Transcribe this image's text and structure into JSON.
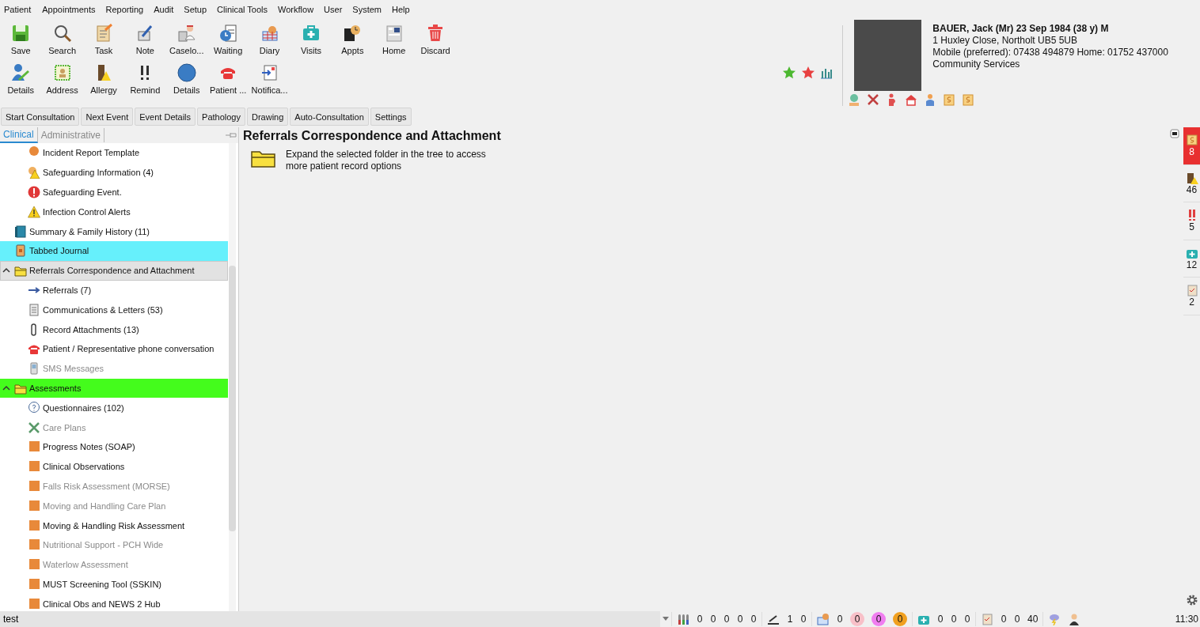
{
  "menu": [
    "Patient",
    "Appointments",
    "Reporting",
    "Audit",
    "Setup",
    "Clinical Tools",
    "Workflow",
    "User",
    "System",
    "Help"
  ],
  "toolbar": [
    [
      {
        "label": "Save"
      },
      {
        "label": "Search"
      },
      {
        "label": "Task"
      },
      {
        "label": "Note"
      },
      {
        "label": "Caselo..."
      },
      {
        "label": "Waiting"
      },
      {
        "label": "Diary"
      },
      {
        "label": "Visits"
      },
      {
        "label": "Appts"
      },
      {
        "label": "Home"
      },
      {
        "label": "Discard"
      }
    ],
    [
      {
        "label": "Details"
      },
      {
        "label": "Address"
      },
      {
        "label": "Allergy"
      },
      {
        "label": "Remind"
      },
      {
        "label": "Details"
      },
      {
        "label": "Patient ..."
      },
      {
        "label": "Notifica..."
      }
    ]
  ],
  "action_buttons": [
    "Start Consultation",
    "Next Event",
    "Event Details",
    "Pathology",
    "Drawing",
    "Auto-Consultation",
    "Settings"
  ],
  "patient": {
    "name_line": "BAUER, Jack (Mr) 23 Sep 1984 (38 y) M",
    "address": "1 Huxley Close, Northolt UB5 5UB",
    "phone": "Mobile (preferred): 07438 494879 Home: 01752 437000",
    "service": "Community Services"
  },
  "side_panel": {
    "tabs": [
      {
        "label": "Clinical",
        "selected": true
      },
      {
        "label": "Administrative",
        "selected": false
      }
    ],
    "tree_continued": [
      {
        "label": "Incident Report Template",
        "kind": "blob",
        "disabled": false,
        "selected": false
      },
      {
        "label": "Safeguarding Information (4)",
        "kind": "hazard",
        "disabled": false,
        "selected": false
      },
      {
        "label": "Safeguarding Event.",
        "kind": "alert",
        "disabled": false,
        "selected": false
      },
      {
        "label": "Infection Control Alerts",
        "kind": "warning",
        "disabled": false,
        "selected": false
      }
    ],
    "tree": [
      {
        "label": "Summary & Family History (11)",
        "kind": "book",
        "disabled": false,
        "selected": false
      },
      {
        "label": "Tabbed Journal",
        "kind": "journal",
        "disabled": false,
        "selected": false,
        "color": "#66f0fc"
      },
      {
        "label": "Referrals Correspondence and Attachment",
        "kind": "folder",
        "disabled": false,
        "selected": true,
        "expanded": true,
        "children": [
          {
            "label": "Referrals (7)",
            "kind": "arrow",
            "disabled": false,
            "selected": false
          },
          {
            "label": "Communications & Letters (53)",
            "kind": "letters",
            "disabled": false,
            "selected": false
          },
          {
            "label": "Record Attachments (13)",
            "kind": "clip",
            "disabled": false,
            "selected": false
          },
          {
            "label": "Patient / Representative phone conversation",
            "kind": "phone",
            "disabled": false,
            "selected": false
          },
          {
            "label": "SMS Messages",
            "kind": "mobile",
            "disabled": true,
            "selected": false
          }
        ]
      },
      {
        "label": "Assessments",
        "kind": "folder",
        "disabled": false,
        "selected": false,
        "expanded": true,
        "color": "#44fc1c",
        "children": [
          {
            "label": "Questionnaires (102)",
            "kind": "question",
            "disabled": false,
            "selected": false
          },
          {
            "label": "Care Plans",
            "kind": "tools",
            "disabled": true,
            "selected": false
          },
          {
            "label": "Progress Notes (SOAP)",
            "kind": "form",
            "disabled": false,
            "selected": false
          },
          {
            "label": "Clinical Observations",
            "kind": "form",
            "disabled": false,
            "selected": false
          },
          {
            "label": "Falls Risk Assessment (MORSE)",
            "kind": "form",
            "disabled": true,
            "selected": false
          },
          {
            "label": "Moving and Handling Care Plan",
            "kind": "form",
            "disabled": true,
            "selected": false
          },
          {
            "label": "Moving & Handling Risk Assessment",
            "kind": "form",
            "disabled": false,
            "selected": false
          },
          {
            "label": "Nutritional Support - PCH Wide",
            "kind": "form",
            "disabled": true,
            "selected": false
          },
          {
            "label": "Waterlow Assessment",
            "kind": "form",
            "disabled": true,
            "selected": false
          },
          {
            "label": "MUST Screening Tool (SSKIN)",
            "kind": "form",
            "disabled": false,
            "selected": false
          },
          {
            "label": "Clinical Obs and NEWS 2 Hub",
            "kind": "form",
            "disabled": false,
            "selected": false
          }
        ]
      }
    ]
  },
  "main": {
    "title": "Referrals Correspondence and Attachment",
    "hint": "Expand the selected folder in the tree to access more patient record options"
  },
  "right_badges": [
    {
      "count": "8",
      "alert": true
    },
    {
      "count": "46",
      "alert": false
    },
    {
      "count": "5",
      "alert": false
    },
    {
      "count": "12",
      "alert": false
    },
    {
      "count": "2",
      "alert": false
    }
  ],
  "search": {
    "value": "test"
  },
  "status_groups": [
    [
      {
        "text": "0"
      },
      {
        "text": "0"
      },
      {
        "text": "0"
      },
      {
        "text": "0"
      },
      {
        "text": "0"
      }
    ],
    [
      {
        "text": "1"
      },
      {
        "text": "0"
      }
    ],
    [
      {
        "text": "0"
      },
      {
        "text": "0",
        "color": "#f8c0c8"
      },
      {
        "text": "0",
        "color": "#f07ef0"
      },
      {
        "text": "0",
        "color": "#f0a020"
      }
    ],
    [
      {
        "text": "0"
      },
      {
        "text": "0"
      },
      {
        "text": "0"
      }
    ],
    [
      {
        "text": "0"
      },
      {
        "text": "0"
      },
      {
        "text": "40"
      }
    ]
  ],
  "clock": "11:30"
}
